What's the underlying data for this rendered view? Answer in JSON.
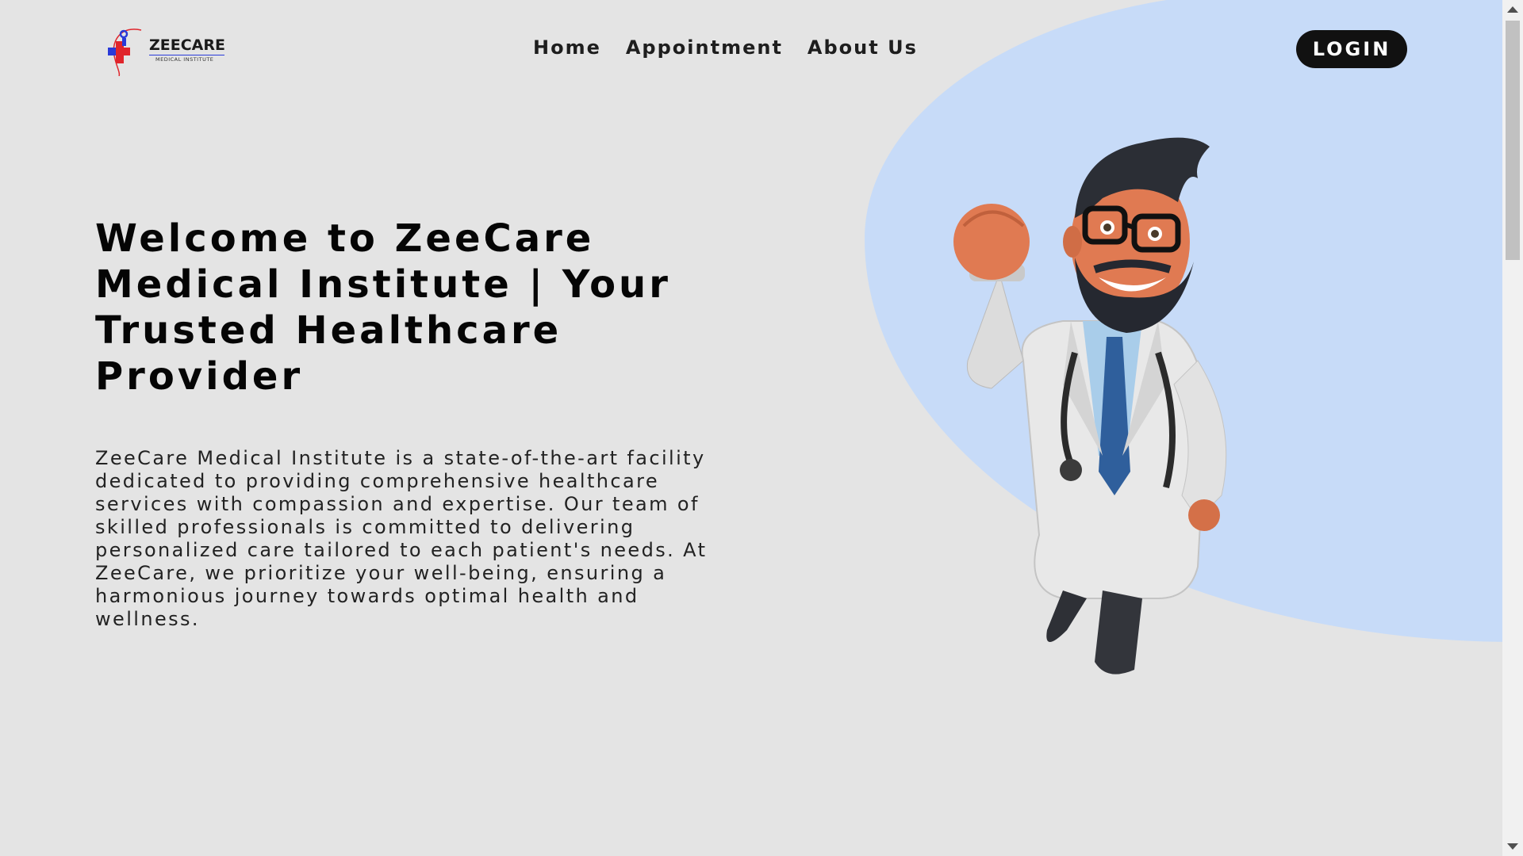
{
  "logo": {
    "title": "ZEECARE",
    "subtitle": "MEDICAL INSTITUTE",
    "icon": "medical-cross-logo-icon"
  },
  "nav": {
    "items": [
      "Home",
      "Appointment",
      "About Us"
    ]
  },
  "header": {
    "login_label": "LOGIN"
  },
  "hero": {
    "title": "Welcome to ZeeCare Medical Institute | Your Trusted Healthcare Provider",
    "description": "ZeeCare Medical Institute is a state-of-the-art facility dedicated to providing comprehensive healthcare services with compassion and expertise. Our team of skilled professionals is committed to delivering personalized care tailored to each patient's needs. At ZeeCare, we prioritize your well-being, ensuring a harmonious journey towards optimal health and wellness.",
    "image": "cartoon-doctor-illustration"
  },
  "colors": {
    "background": "#e4e4e4",
    "accent_blob": "#c7dbf8",
    "button": "#111111",
    "logo_red": "#e0252b",
    "logo_blue": "#2a3ad8"
  }
}
